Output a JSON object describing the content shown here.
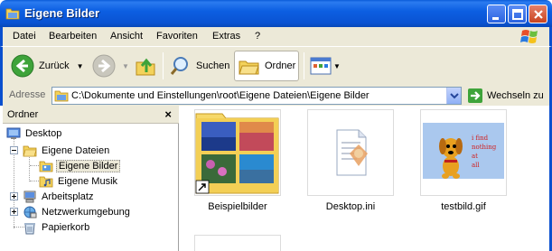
{
  "window": {
    "title": "Eigene Bilder"
  },
  "menu": {
    "items": [
      "Datei",
      "Bearbeiten",
      "Ansicht",
      "Favoriten",
      "Extras",
      "?"
    ]
  },
  "toolbar": {
    "back_label": "Zurück",
    "search_label": "Suchen",
    "folders_label": "Ordner"
  },
  "address": {
    "label": "Adresse",
    "path": "C:\\Dokumente und Einstellungen\\root\\Eigene Dateien\\Eigene Bilder",
    "go_label": "Wechseln zu"
  },
  "folders_pane": {
    "title": "Ordner",
    "close": "×",
    "tree": [
      {
        "label": "Desktop"
      },
      {
        "label": "Eigene Dateien"
      },
      {
        "label": "Eigene Bilder",
        "selected": true
      },
      {
        "label": "Eigene Musik"
      },
      {
        "label": "Arbeitsplatz"
      },
      {
        "label": "Netzwerkumgebung"
      },
      {
        "label": "Papierkorb"
      }
    ]
  },
  "files": [
    {
      "name": "Beispielbilder",
      "type": "folder-shortcut"
    },
    {
      "name": "Desktop.ini",
      "type": "ini"
    },
    {
      "name": "testbild.gif",
      "type": "gif",
      "image_text": [
        "i find",
        "nothing",
        "at",
        "all"
      ]
    }
  ],
  "colors": {
    "titlebar": "#0a5bd8",
    "chrome": "#ece9d8",
    "selection": "#316ac5"
  }
}
